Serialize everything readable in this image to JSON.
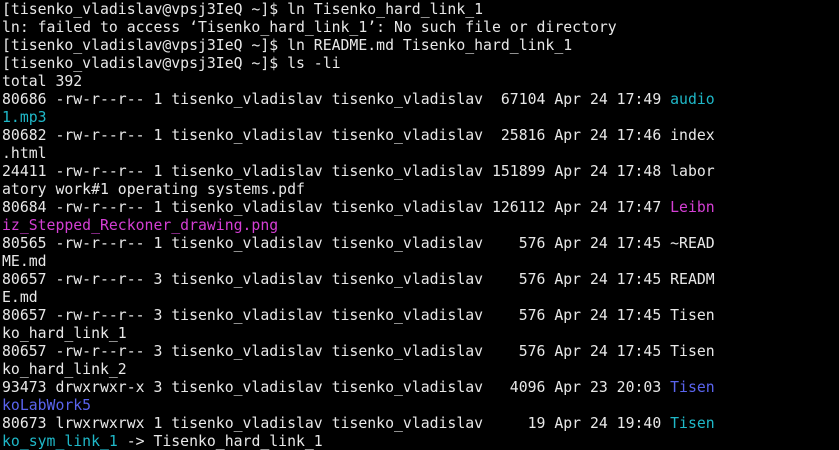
{
  "colors": {
    "background": "#000000",
    "text": "#e8e8e8",
    "audio": "#1fb8c8",
    "image": "#d43fd4",
    "directory": "#5a64ee",
    "symlink": "#1fb8c8"
  },
  "lines": [
    {
      "segments": [
        {
          "text": "[tisenko_vladislav@vpsj3IeQ ~]$ ln Tisenko_hard_link_1",
          "color": "default"
        }
      ]
    },
    {
      "segments": [
        {
          "text": "ln: failed to access ‘Tisenko_hard_link_1’: No such file or directory",
          "color": "default"
        }
      ]
    },
    {
      "segments": [
        {
          "text": "[tisenko_vladislav@vpsj3IeQ ~]$ ln README.md Tisenko_hard_link_1",
          "color": "default"
        }
      ]
    },
    {
      "segments": [
        {
          "text": "[tisenko_vladislav@vpsj3IeQ ~]$ ls -li",
          "color": "default"
        }
      ]
    },
    {
      "segments": [
        {
          "text": "total 392",
          "color": "default"
        }
      ]
    },
    {
      "segments": [
        {
          "text": "80686 -rw-r--r-- 1 tisenko_vladislav tisenko_vladislav  67104 Apr 24 17:49 ",
          "color": "default"
        },
        {
          "text": "audio",
          "color": "cyan"
        }
      ]
    },
    {
      "segments": [
        {
          "text": "1.mp3",
          "color": "cyan"
        }
      ]
    },
    {
      "segments": [
        {
          "text": "80682 -rw-r--r-- 1 tisenko_vladislav tisenko_vladislav  25816 Apr 24 17:46 index",
          "color": "default"
        }
      ]
    },
    {
      "segments": [
        {
          "text": ".html",
          "color": "default"
        }
      ]
    },
    {
      "segments": [
        {
          "text": "24411 -rw-r--r-- 1 tisenko_vladislav tisenko_vladislav 151899 Apr 24 17:48 labor",
          "color": "default"
        }
      ]
    },
    {
      "segments": [
        {
          "text": "atory work#1 operating systems.pdf",
          "color": "default"
        }
      ]
    },
    {
      "segments": [
        {
          "text": "80684 -rw-r--r-- 1 tisenko_vladislav tisenko_vladislav 126112 Apr 24 17:47 ",
          "color": "default"
        },
        {
          "text": "Leibn",
          "color": "magenta"
        }
      ]
    },
    {
      "segments": [
        {
          "text": "iz_Stepped_Reckoner_drawing.png",
          "color": "magenta"
        }
      ]
    },
    {
      "segments": [
        {
          "text": "80565 -rw-r--r-- 1 tisenko_vladislav tisenko_vladislav    576 Apr 24 17:45 ~READ",
          "color": "default"
        }
      ]
    },
    {
      "segments": [
        {
          "text": "ME.md",
          "color": "default"
        }
      ]
    },
    {
      "segments": [
        {
          "text": "80657 -rw-r--r-- 3 tisenko_vladislav tisenko_vladislav    576 Apr 24 17:45 READM",
          "color": "default"
        }
      ]
    },
    {
      "segments": [
        {
          "text": "E.md",
          "color": "default"
        }
      ]
    },
    {
      "segments": [
        {
          "text": "80657 -rw-r--r-- 3 tisenko_vladislav tisenko_vladislav    576 Apr 24 17:45 Tisen",
          "color": "default"
        }
      ]
    },
    {
      "segments": [
        {
          "text": "ko_hard_link_1",
          "color": "default"
        }
      ]
    },
    {
      "segments": [
        {
          "text": "80657 -rw-r--r-- 3 tisenko_vladislav tisenko_vladislav    576 Apr 24 17:45 Tisen",
          "color": "default"
        }
      ]
    },
    {
      "segments": [
        {
          "text": "ko_hard_link_2",
          "color": "default"
        }
      ]
    },
    {
      "segments": [
        {
          "text": "93473 drwxrwxr-x 3 tisenko_vladislav tisenko_vladislav   4096 Apr 23 20:03 ",
          "color": "default"
        },
        {
          "text": "Tisen",
          "color": "blue"
        }
      ]
    },
    {
      "segments": [
        {
          "text": "koLabWork5",
          "color": "blue"
        }
      ]
    },
    {
      "segments": [
        {
          "text": "80673 lrwxrwxrwx 1 tisenko_vladislav tisenko_vladislav     19 Apr 24 19:40 ",
          "color": "default"
        },
        {
          "text": "Tisen",
          "color": "cyan"
        }
      ]
    },
    {
      "segments": [
        {
          "text": "ko_sym_link_1",
          "color": "cyan"
        },
        {
          "text": " -> Tisenko_hard_link_1",
          "color": "default"
        }
      ]
    }
  ]
}
